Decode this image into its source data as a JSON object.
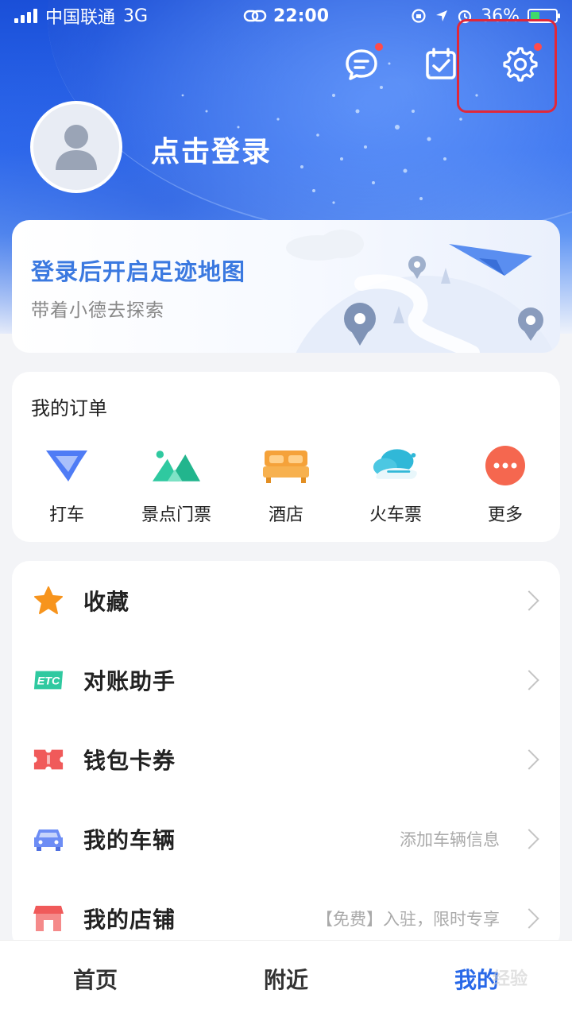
{
  "status_bar": {
    "carrier": "中国联通",
    "network": "3G",
    "time": "22:00",
    "battery": "36%",
    "battery_level": 0.36
  },
  "header": {
    "login_prompt": "点击登录",
    "icons": [
      "message-icon",
      "checkin-icon",
      "gear-icon"
    ]
  },
  "footprint": {
    "title": "登录后开启足迹地图",
    "subtitle": "带着小德去探索"
  },
  "orders": {
    "title": "我的订单",
    "items": [
      {
        "label": "打车",
        "icon": "taxi-icon",
        "color": "#4f7cf5"
      },
      {
        "label": "景点门票",
        "icon": "mountain-icon",
        "color": "#2fc9a0"
      },
      {
        "label": "酒店",
        "icon": "bed-icon",
        "color": "#f5a23a"
      },
      {
        "label": "火车票",
        "icon": "train-icon",
        "color": "#30b8d8"
      },
      {
        "label": "更多",
        "icon": "more-icon",
        "color": "#f5674f"
      }
    ]
  },
  "menu": {
    "items": [
      {
        "label": "收藏",
        "hint": "",
        "icon": "star-icon"
      },
      {
        "label": "对账助手",
        "hint": "",
        "icon": "etc-icon",
        "badge_text": "ETC"
      },
      {
        "label": "钱包卡券",
        "hint": "",
        "icon": "ticket-icon"
      },
      {
        "label": "我的车辆",
        "hint": "添加车辆信息",
        "icon": "car-icon"
      },
      {
        "label": "我的店铺",
        "hint": "【免费】入驻，限时专享",
        "icon": "shop-icon"
      }
    ]
  },
  "tabbar": {
    "tabs": [
      "首页",
      "附近",
      "我的"
    ],
    "active": 2
  },
  "watermark": "经验"
}
